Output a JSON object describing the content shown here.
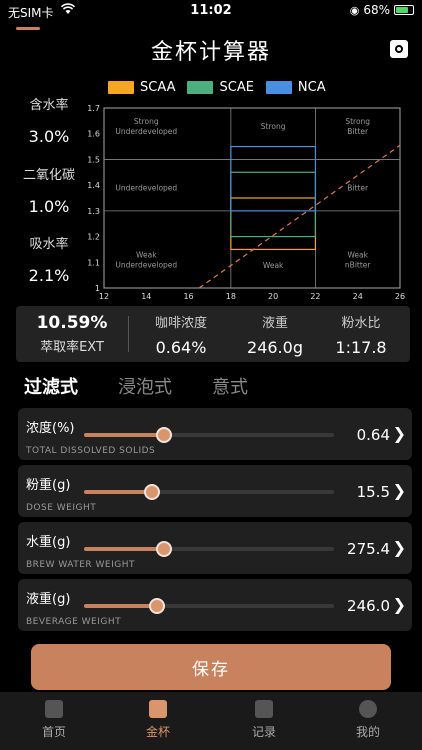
{
  "status": {
    "carrier": "无SIM卡",
    "time": "11:02",
    "battery": "68%"
  },
  "nav": {
    "title": "金杯计算器"
  },
  "legend": [
    {
      "label": "SCAA",
      "color": "#f5a623"
    },
    {
      "label": "SCAE",
      "color": "#4caf7d"
    },
    {
      "label": "NCA",
      "color": "#4a90e2"
    }
  ],
  "side": {
    "water_content_label": "含水率",
    "water_content_value": "3.0%",
    "co2_label": "二氧化碳",
    "co2_value": "1.0%",
    "absorb_label": "吸水率",
    "absorb_value": "2.1%"
  },
  "chart_data": {
    "type": "line",
    "x_ticks": [
      "12",
      "14",
      "16",
      "18",
      "20",
      "22",
      "24",
      "26"
    ],
    "y_ticks": [
      "1",
      "1.1",
      "1.2",
      "1.3",
      "1.4",
      "1.5",
      "1.6",
      "1.7"
    ],
    "xlim": [
      12,
      26
    ],
    "ylim": [
      1.0,
      1.7
    ],
    "regions": [
      {
        "label": "Strong\nUnderdeveloped",
        "x": 14,
        "y": 1.63
      },
      {
        "label": "Strong",
        "x": 20,
        "y": 1.63
      },
      {
        "label": "Strong\nBitter",
        "x": 24,
        "y": 1.63
      },
      {
        "label": "Underdeveloped",
        "x": 14,
        "y": 1.39
      },
      {
        "label": "Bitter",
        "x": 24,
        "y": 1.39
      },
      {
        "label": "Weak\nUnderdeveloped",
        "x": 14,
        "y": 1.11
      },
      {
        "label": "Weak",
        "x": 20,
        "y": 1.09
      },
      {
        "label": "Weak\nnBitter",
        "x": 24,
        "y": 1.11
      }
    ],
    "boxes": [
      {
        "name": "SCAA",
        "x0": 18,
        "x1": 22,
        "y0": 1.15,
        "y1": 1.35,
        "color": "#f5a623"
      },
      {
        "name": "SCAE",
        "x0": 18,
        "x1": 22,
        "y0": 1.2,
        "y1": 1.45,
        "color": "#4caf7d"
      },
      {
        "name": "NCA",
        "x0": 18,
        "x1": 22,
        "y0": 1.3,
        "y1": 1.55,
        "color": "#4a90e2"
      }
    ],
    "ratio_line": {
      "x0": 16.5,
      "y0": 1.0,
      "x1": 26,
      "y1": 1.555,
      "color": "#e07a4a"
    }
  },
  "summary": {
    "ext_value": "10.59%",
    "ext_label": "萃取率EXT",
    "tds_label": "咖啡浓度",
    "tds_value": "0.64%",
    "bev_label": "液重",
    "bev_value": "246.0g",
    "ratio_label": "粉水比",
    "ratio_value": "1:17.8"
  },
  "tabs": [
    "过滤式",
    "浸泡式",
    "意式"
  ],
  "sliders": [
    {
      "title": "浓度(%)",
      "sub": "TOTAL DISSOLVED SOLIDS",
      "value": "0.64",
      "level": 0.32
    },
    {
      "title": "粉重(g)",
      "sub": "DOSE WEIGHT",
      "value": "15.5",
      "level": 0.27
    },
    {
      "title": "水重(g)",
      "sub": "BREW WATER WEIGHT",
      "value": "275.4",
      "level": 0.32
    },
    {
      "title": "液重(g)",
      "sub": "BEVERAGE WEIGHT",
      "value": "246.0",
      "level": 0.29
    }
  ],
  "save_label": "保存",
  "tabbar": [
    "首页",
    "金杯",
    "记录",
    "我的"
  ]
}
